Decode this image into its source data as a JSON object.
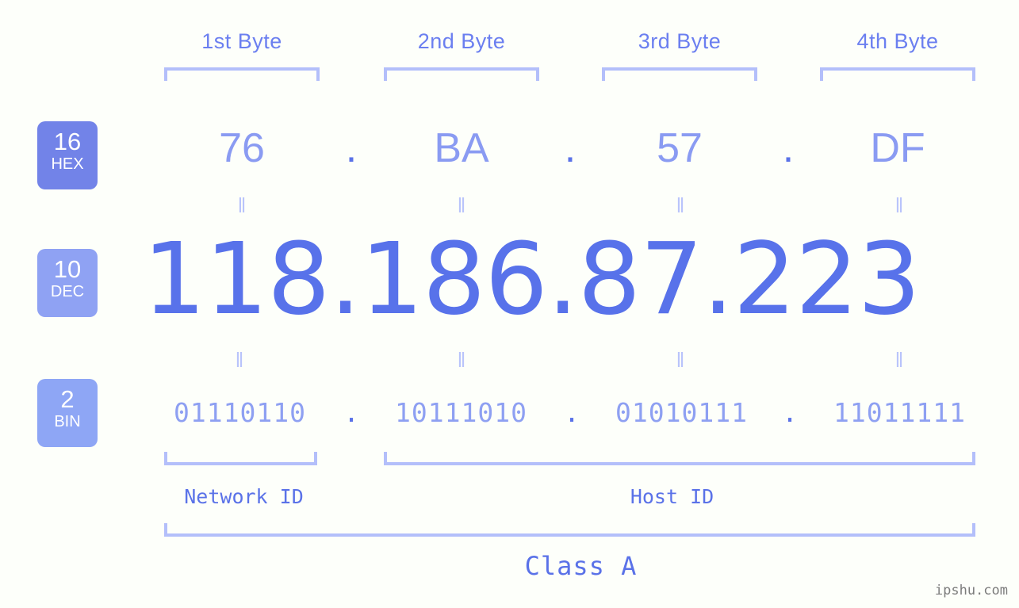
{
  "page": {
    "background_color": "#fdfffa",
    "accent_color": "#5a72e8",
    "accent_light": "#8ea0f2",
    "bracket_color": "#b3bffa",
    "watermark": "ipshu.com"
  },
  "byte_headers": [
    {
      "label": "1st Byte"
    },
    {
      "label": "2nd Byte"
    },
    {
      "label": "3rd Byte"
    },
    {
      "label": "4th Byte"
    }
  ],
  "bases": {
    "hex": {
      "number": "16",
      "name": "HEX",
      "badge_color": "#7283e8"
    },
    "dec": {
      "number": "10",
      "name": "DEC",
      "badge_color": "#8fa2f3"
    },
    "bin": {
      "number": "2",
      "name": "BIN",
      "badge_color": "#8ea6f5"
    }
  },
  "separator": ".",
  "equals_glyph": "‖",
  "rows": {
    "hex": [
      "76",
      "BA",
      "57",
      "DF"
    ],
    "dec": [
      "118",
      "186",
      "87",
      "223"
    ],
    "bin": [
      "01110110",
      "10111010",
      "01010111",
      "11011111"
    ]
  },
  "ip": {
    "decimal": "118.186.87.223",
    "hexadecimal": "76.BA.57.DF",
    "binary": "01110110.10111010.01010111.11011111"
  },
  "segments": {
    "network_id": {
      "label": "Network ID",
      "bytes": [
        1
      ]
    },
    "host_id": {
      "label": "Host ID",
      "bytes": [
        2,
        3,
        4
      ]
    },
    "class": {
      "label": "Class A"
    }
  }
}
